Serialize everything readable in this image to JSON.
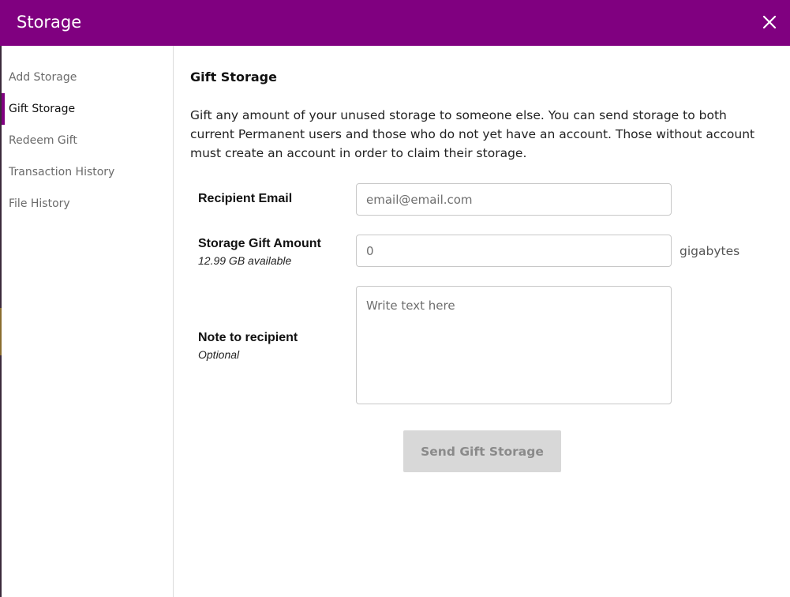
{
  "modal": {
    "title": "Storage",
    "close_icon": "close-icon"
  },
  "sidebar": {
    "items": [
      {
        "label": "Add Storage",
        "active": false
      },
      {
        "label": "Gift Storage",
        "active": true
      },
      {
        "label": "Redeem Gift",
        "active": false
      },
      {
        "label": "Transaction History",
        "active": false
      },
      {
        "label": "File History",
        "active": false
      }
    ]
  },
  "gift": {
    "title": "Gift Storage",
    "description": "Gift any amount of your unused storage to someone else. You can send storage to both current Permanent users and those who do not yet have an account. Those without account must create an account in order to claim their storage.",
    "recipient_email": {
      "label": "Recipient Email",
      "placeholder": "email@email.com",
      "value": ""
    },
    "amount": {
      "label": "Storage Gift Amount",
      "available": "12.99 GB available",
      "value": "0",
      "unit": "gigabytes"
    },
    "note": {
      "label": "Note to recipient",
      "sub": "Optional",
      "placeholder": "Write text here",
      "value": ""
    },
    "send_label": "Send Gift Storage"
  },
  "colors": {
    "header": "#800080",
    "accent": "#800080",
    "button_disabled_bg": "#d8d8d8",
    "button_disabled_text": "#8a8a8a"
  }
}
